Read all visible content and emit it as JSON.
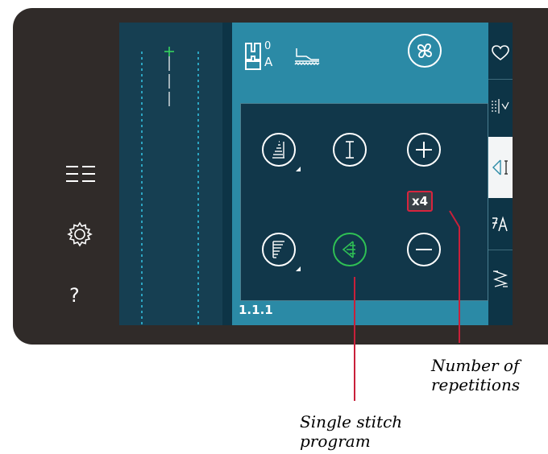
{
  "sidebar": {
    "menu_icon": "menu-icon",
    "settings_icon": "gear-icon",
    "help_glyph": "?"
  },
  "header": {
    "presser_foot_code": "0",
    "presser_foot_letter": "A"
  },
  "controls": {
    "repetitions_value": "x4",
    "program_label": "1.1.1"
  },
  "callouts": {
    "repetitions_line1": "Number of",
    "repetitions_line2": "repetitions",
    "single_stitch_line1": "Single stitch",
    "single_stitch_line2": "program"
  },
  "colors": {
    "accent_red": "#d7243e",
    "active_green": "#2fc054",
    "panel_blue": "#2b8aa6",
    "screen_dark": "#0d3446"
  }
}
